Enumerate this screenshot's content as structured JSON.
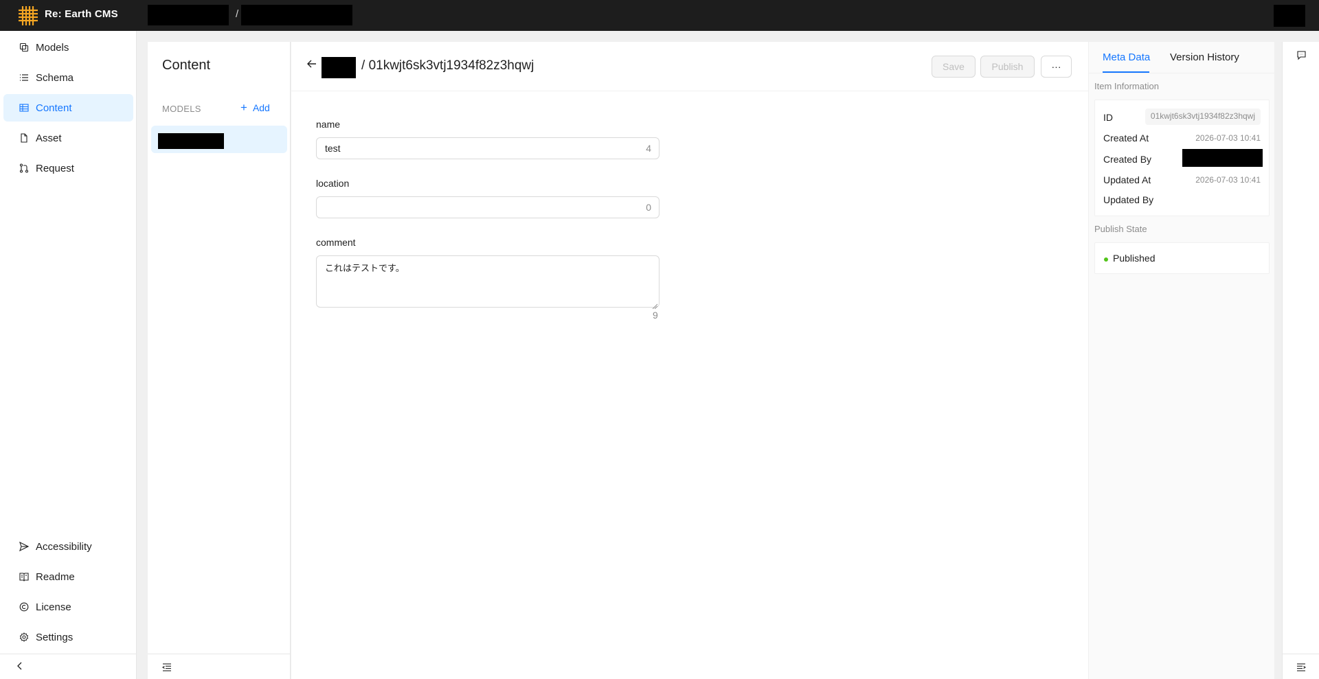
{
  "app": {
    "brand": "Re: Earth CMS",
    "breadcrumb_separator": "/"
  },
  "nav": {
    "items": [
      {
        "label": "Models",
        "icon": "models-icon"
      },
      {
        "label": "Schema",
        "icon": "schema-icon"
      },
      {
        "label": "Content",
        "icon": "content-table-icon",
        "active": true
      },
      {
        "label": "Asset",
        "icon": "file-icon"
      },
      {
        "label": "Request",
        "icon": "pull-request-icon"
      }
    ],
    "bottom_items": [
      {
        "label": "Accessibility",
        "icon": "send-icon"
      },
      {
        "label": "Readme",
        "icon": "book-icon"
      },
      {
        "label": "License",
        "icon": "copyright-icon"
      },
      {
        "label": "Settings",
        "icon": "gear-icon"
      }
    ]
  },
  "models_panel": {
    "title": "Content",
    "section_label": "MODELS",
    "add_label": "Add"
  },
  "item": {
    "title_separator": "/",
    "id": "01kwjt6sk3vtj1934f82z3hqwj",
    "save_label": "Save",
    "publish_label": "Publish",
    "more_label": "···"
  },
  "fields": {
    "name": {
      "label": "name",
      "value": "test",
      "count": "4"
    },
    "location": {
      "label": "location",
      "value": "",
      "count": "0"
    },
    "comment": {
      "label": "comment",
      "value": "これはテストです。",
      "count": "9"
    }
  },
  "meta": {
    "tabs": [
      "Meta Data",
      "Version History"
    ],
    "item_info_label": "Item Information",
    "rows": {
      "id_key": "ID",
      "id_val": "01kwjt6sk3vtj1934f82z3hqwj",
      "created_at_key": "Created At",
      "created_at_val": "2026-07-03 10:41",
      "created_by_key": "Created By",
      "updated_at_key": "Updated At",
      "updated_at_val": "2026-07-03 10:41",
      "updated_by_key": "Updated By"
    },
    "publish_state_label": "Publish State",
    "publish_state": "Published",
    "status_color": "#52c41a"
  },
  "colors": {
    "accent": "#1677ff",
    "header_bg": "#1d1d1d",
    "logo": "#f5a623"
  }
}
